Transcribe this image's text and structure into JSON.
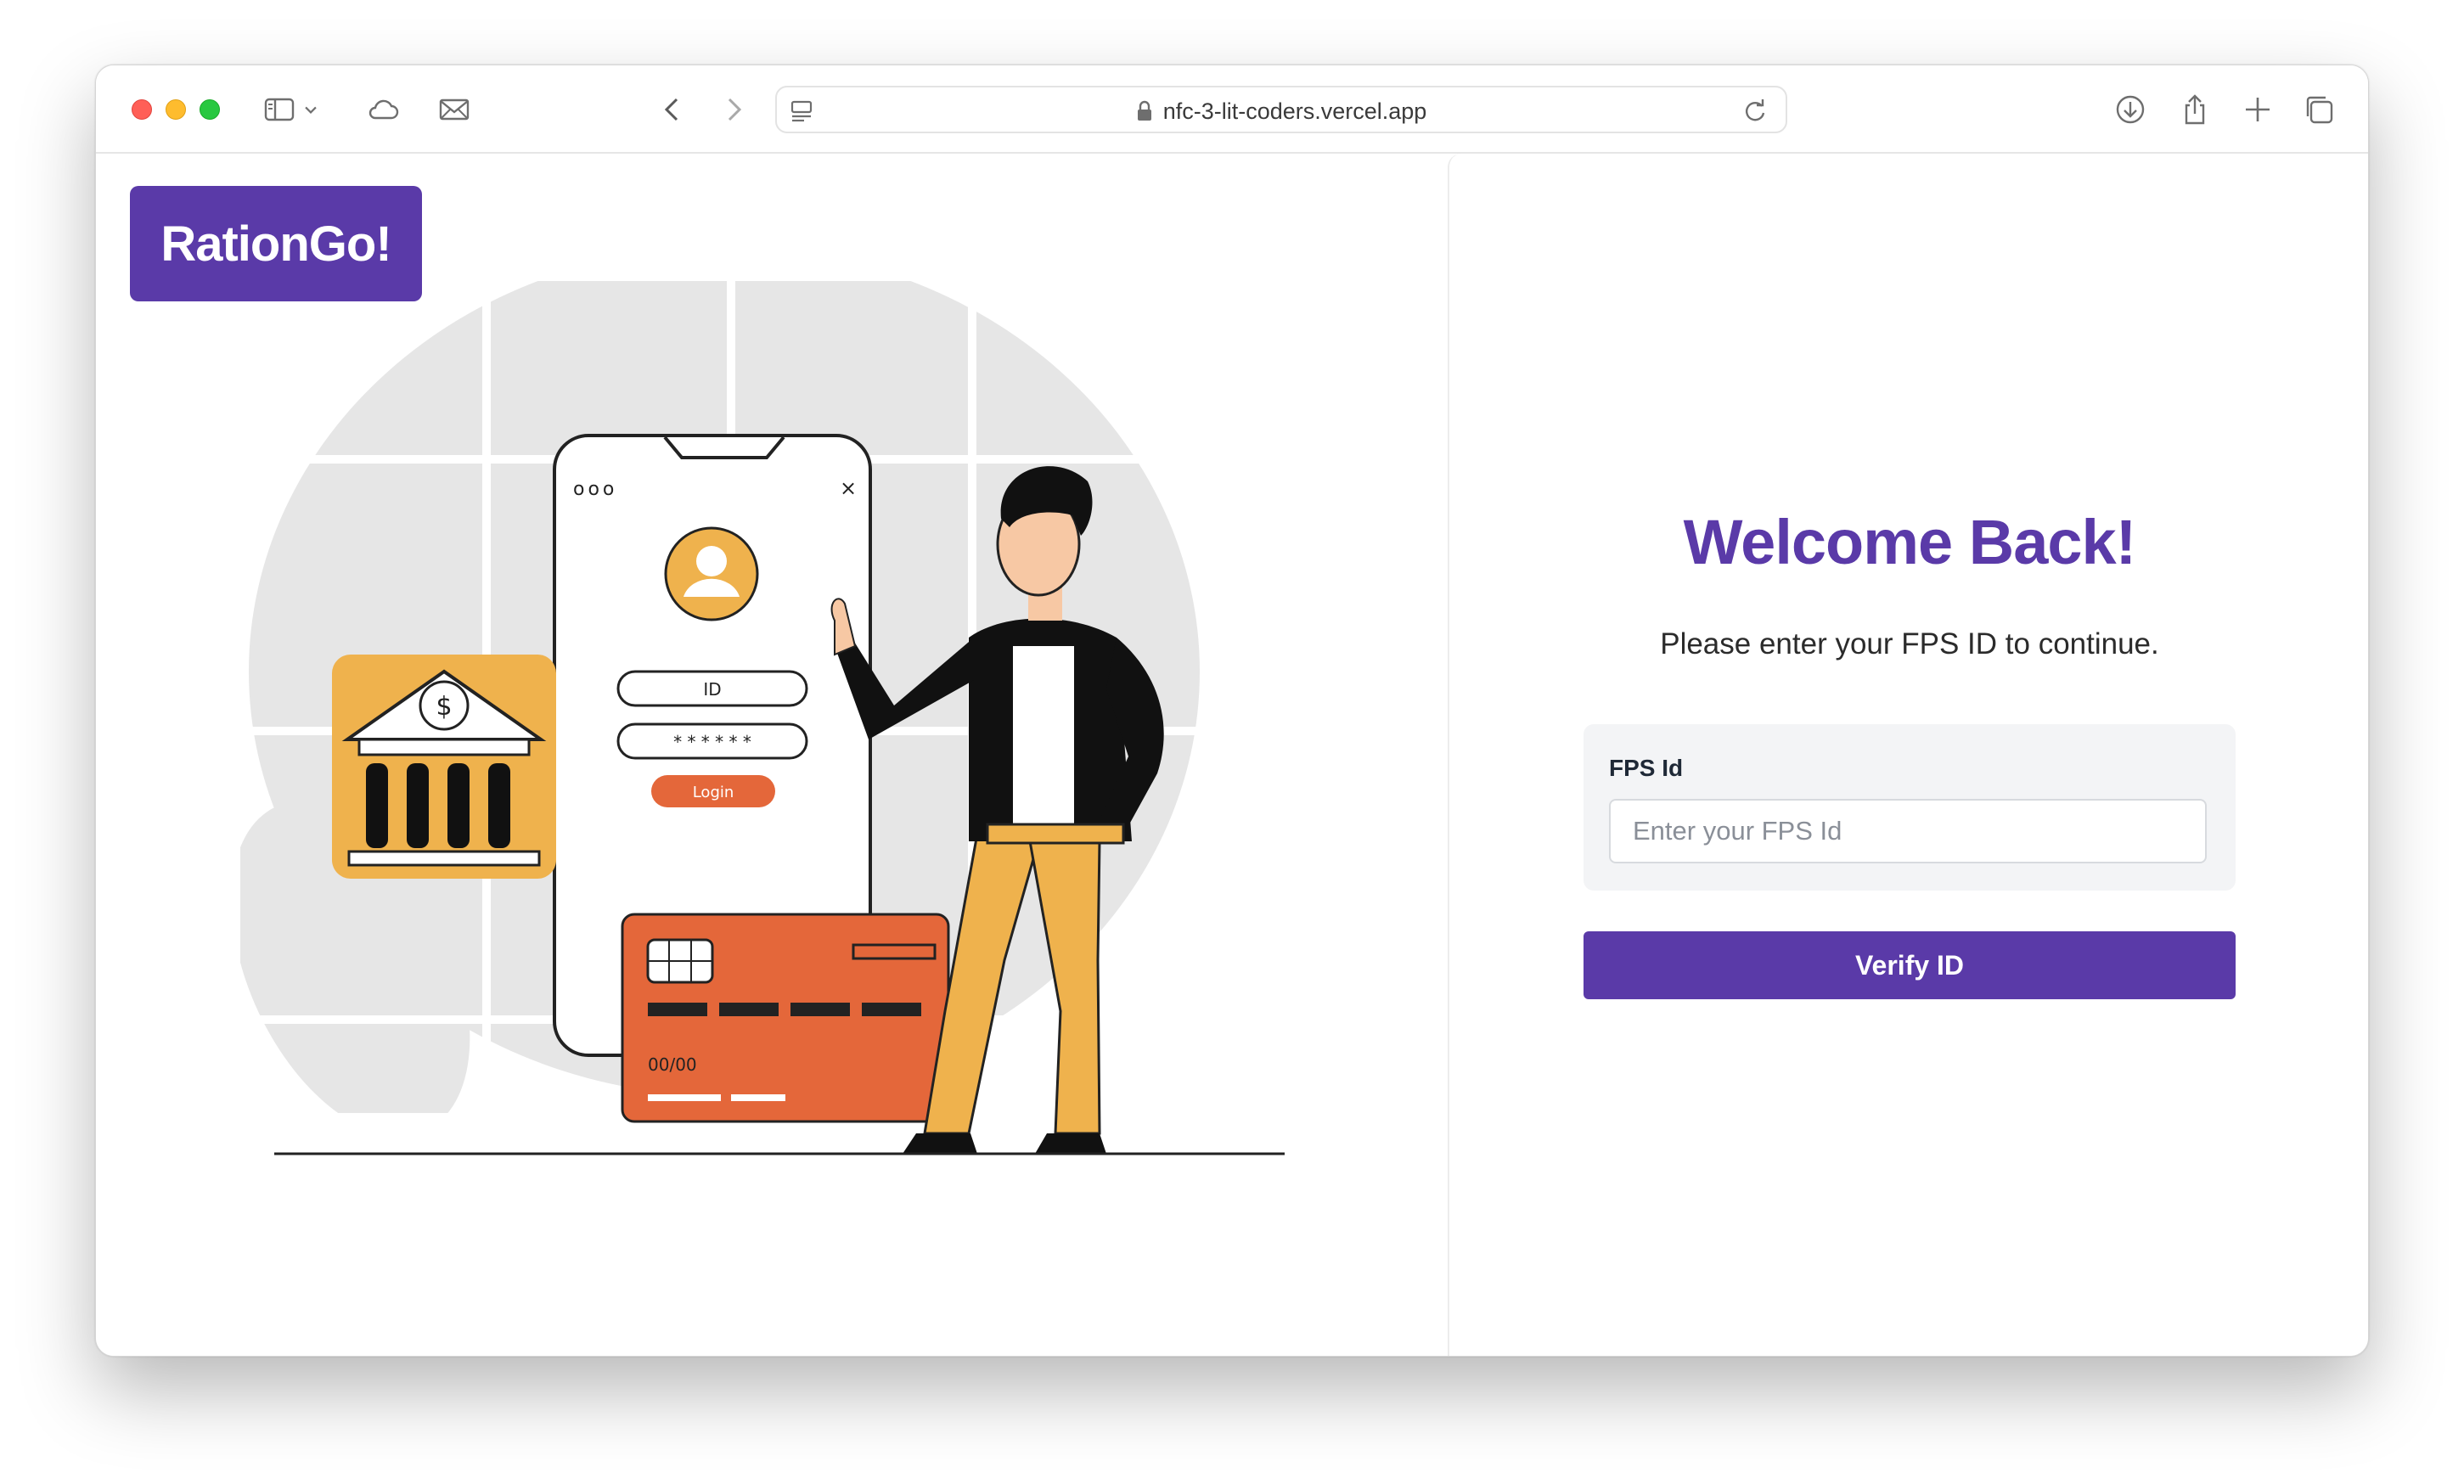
{
  "browser": {
    "url": "nfc-3-lit-coders.vercel.app",
    "toolbar_icons": [
      "sidebar-icon",
      "chevron-down-icon",
      "cloud-icon",
      "mail-icon",
      "back-icon",
      "forward-icon",
      "reader-icon",
      "lock-icon",
      "reload-icon",
      "download-icon",
      "share-icon",
      "plus-icon",
      "tabs-icon"
    ]
  },
  "brand": {
    "logo_text": "RationGo!",
    "color": "#5a3aa8"
  },
  "illustration": {
    "phone": {
      "dots": "ooo",
      "close": "×",
      "id_label": "ID",
      "password_mask": "* * * * * *",
      "login_label": "Login"
    },
    "bank": {
      "symbol": "$"
    },
    "card": {
      "expiry": "00/00"
    },
    "colors": {
      "orange": "#e4673a",
      "yellow": "#efb24d",
      "gray": "#e6e6e6"
    }
  },
  "login": {
    "title": "Welcome Back!",
    "subtitle": "Please enter your FPS ID to continue.",
    "field_label": "FPS Id",
    "field_placeholder": "Enter your FPS Id",
    "field_value": "",
    "button_label": "Verify ID"
  }
}
